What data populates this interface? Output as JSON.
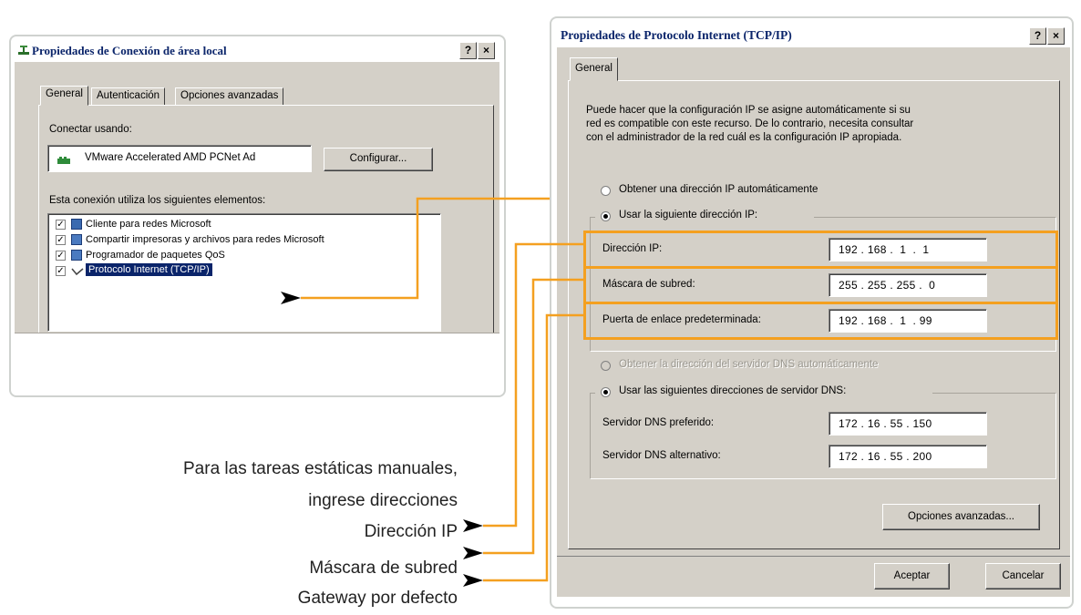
{
  "lan_dialog": {
    "title": "Propiedades de Conexión de área local",
    "help_button": "?",
    "close_button": "×",
    "tabs": [
      "General",
      "Autenticación",
      "Opciones avanzadas"
    ],
    "connect_using_label": "Conectar usando:",
    "adapter_name": "VMware Accelerated AMD PCNet Ad",
    "configure_button": "Configurar...",
    "elements_label": "Esta conexión utiliza los siguientes elementos:",
    "components": [
      {
        "label": "Cliente para redes Microsoft",
        "checked": true
      },
      {
        "label": "Compartir impresoras y archivos para redes Microsoft",
        "checked": true
      },
      {
        "label": "Programador de paquetes QoS",
        "checked": true
      },
      {
        "label": "Protocolo Internet (TCP/IP)",
        "checked": true,
        "selected": true
      }
    ]
  },
  "tcp_dialog": {
    "title": "Propiedades de Protocolo Internet (TCP/IP)",
    "help_button": "?",
    "close_button": "×",
    "tab": "General",
    "description": [
      "Puede hacer que la configuración IP se asigne automáticamente si su",
      "red es compatible con este recurso. De lo contrario, necesita consultar",
      "con el administrador de la red cuál es la configuración IP apropiada."
    ],
    "radio_auto_ip": "Obtener una dirección IP automáticamente",
    "radio_manual_ip": "Usar la siguiente dirección IP:",
    "ip_label": "Dirección IP:",
    "ip_value": "192 . 168 .  1  .  1",
    "mask_label": "Máscara de subred:",
    "mask_value": "255 . 255 . 255 .  0",
    "gateway_label": "Puerta de enlace predeterminada:",
    "gateway_value": "192 . 168 .  1  . 99",
    "radio_auto_dns": "Obtener la dirección del servidor DNS automáticamente",
    "radio_manual_dns": "Usar las siguientes direcciones de servidor DNS:",
    "dns_preferred_label": "Servidor DNS preferido:",
    "dns_preferred_value": "172 . 16 . 55 . 150",
    "dns_alternate_label": "Servidor DNS alternativo:",
    "dns_alternate_value": "172 . 16 . 55 . 200",
    "advanced_button": "Opciones avanzadas...",
    "ok_button": "Aceptar",
    "cancel_button": "Cancelar"
  },
  "annotations": {
    "line1": "Para las tareas estáticas manuales,",
    "line2": "ingrese direcciones",
    "ip": "Dirección IP",
    "mask": "Máscara de subred",
    "gateway": "Gateway por defecto"
  },
  "colors": {
    "highlight": "#f4a020",
    "dialog_bg": "#d4d0c8",
    "title_text": "#0a246a",
    "selection": "#0a246a"
  }
}
